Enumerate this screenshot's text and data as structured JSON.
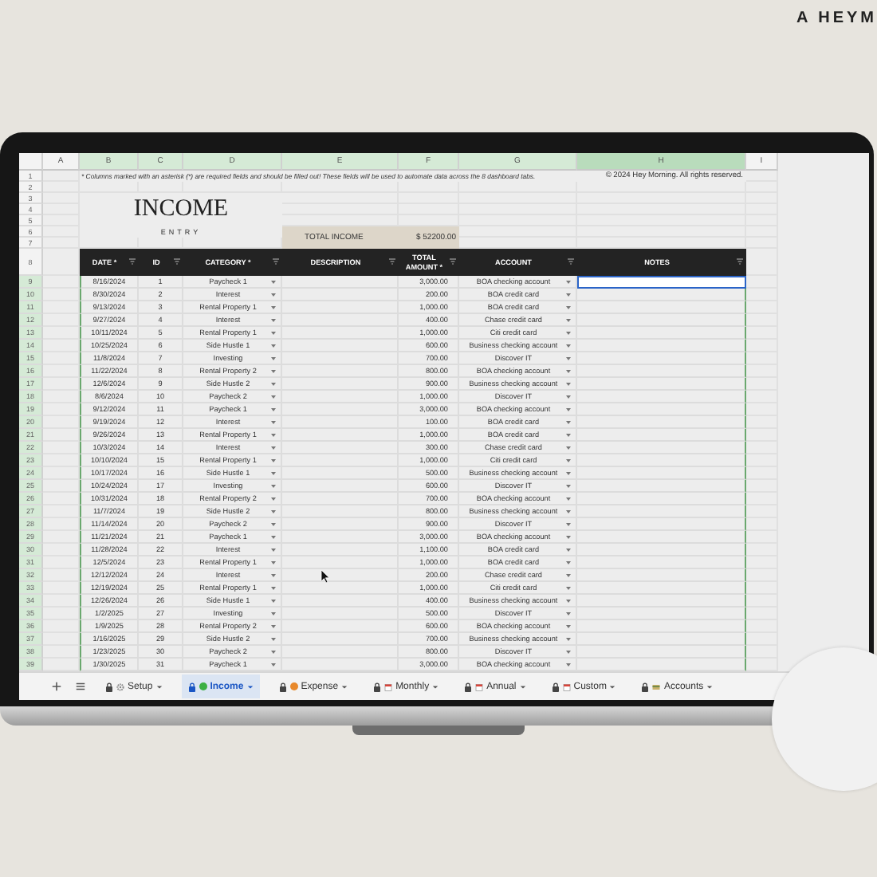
{
  "brand": "A HEYM",
  "columns": [
    {
      "letter": "A",
      "selected": false
    },
    {
      "letter": "B",
      "selected": false
    },
    {
      "letter": "C",
      "selected": false
    },
    {
      "letter": "D",
      "selected": false
    },
    {
      "letter": "E",
      "selected": false
    },
    {
      "letter": "F",
      "selected": false
    },
    {
      "letter": "G",
      "selected": false
    },
    {
      "letter": "H",
      "selected": true
    },
    {
      "letter": "I",
      "selected": false
    }
  ],
  "top_row_numbers": [
    "1",
    "2",
    "3",
    "4",
    "5",
    "6",
    "7"
  ],
  "note": "* Columns marked with an asterisk (*) are required fields and should be filled out! These fields will be used to automate data across the 8 dashboard tabs.",
  "copyright": "© 2024 Hey Morning. All rights reserved.",
  "title": "INCOME",
  "subtitle": "ENTRY",
  "total": {
    "label": "TOTAL INCOME",
    "value": "$ 52200.00"
  },
  "header_row_number": "8",
  "headers": [
    "DATE *",
    "ID",
    "CATEGORY *",
    "DESCRIPTION",
    "TOTAL AMOUNT *",
    "ACCOUNT",
    "NOTES"
  ],
  "rows": [
    {
      "row_number": "9",
      "date": "8/16/2024",
      "id": "1",
      "category": "Paycheck 1",
      "amount": "3,000.00",
      "account": "BOA checking account",
      "selected": true
    },
    {
      "row_number": "10",
      "date": "8/30/2024",
      "id": "2",
      "category": "Interest",
      "amount": "200.00",
      "account": "BOA credit card",
      "selected": false
    },
    {
      "row_number": "11",
      "date": "9/13/2024",
      "id": "3",
      "category": "Rental Property 1",
      "amount": "1,000.00",
      "account": "BOA credit card",
      "selected": false
    },
    {
      "row_number": "12",
      "date": "9/27/2024",
      "id": "4",
      "category": "Interest",
      "amount": "400.00",
      "account": "Chase credit card",
      "selected": false
    },
    {
      "row_number": "13",
      "date": "10/11/2024",
      "id": "5",
      "category": "Rental Property 1",
      "amount": "1,000.00",
      "account": "Citi credit card",
      "selected": false
    },
    {
      "row_number": "14",
      "date": "10/25/2024",
      "id": "6",
      "category": "Side Hustle 1",
      "amount": "600.00",
      "account": "Business checking account",
      "selected": false
    },
    {
      "row_number": "15",
      "date": "11/8/2024",
      "id": "7",
      "category": "Investing",
      "amount": "700.00",
      "account": "Discover IT",
      "selected": false
    },
    {
      "row_number": "16",
      "date": "11/22/2024",
      "id": "8",
      "category": "Rental Property 2",
      "amount": "800.00",
      "account": "BOA checking account",
      "selected": false
    },
    {
      "row_number": "17",
      "date": "12/6/2024",
      "id": "9",
      "category": "Side Hustle 2",
      "amount": "900.00",
      "account": "Business checking account",
      "selected": false
    },
    {
      "row_number": "18",
      "date": "8/6/2024",
      "id": "10",
      "category": "Paycheck 2",
      "amount": "1,000.00",
      "account": "Discover IT",
      "selected": false
    },
    {
      "row_number": "19",
      "date": "9/12/2024",
      "id": "11",
      "category": "Paycheck 1",
      "amount": "3,000.00",
      "account": "BOA checking account",
      "selected": false
    },
    {
      "row_number": "20",
      "date": "9/19/2024",
      "id": "12",
      "category": "Interest",
      "amount": "100.00",
      "account": "BOA credit card",
      "selected": false
    },
    {
      "row_number": "21",
      "date": "9/26/2024",
      "id": "13",
      "category": "Rental Property 1",
      "amount": "1,000.00",
      "account": "BOA credit card",
      "selected": false
    },
    {
      "row_number": "22",
      "date": "10/3/2024",
      "id": "14",
      "category": "Interest",
      "amount": "300.00",
      "account": "Chase credit card",
      "selected": false
    },
    {
      "row_number": "23",
      "date": "10/10/2024",
      "id": "15",
      "category": "Rental Property 1",
      "amount": "1,000.00",
      "account": "Citi credit card",
      "selected": false
    },
    {
      "row_number": "24",
      "date": "10/17/2024",
      "id": "16",
      "category": "Side Hustle 1",
      "amount": "500.00",
      "account": "Business checking account",
      "selected": false
    },
    {
      "row_number": "25",
      "date": "10/24/2024",
      "id": "17",
      "category": "Investing",
      "amount": "600.00",
      "account": "Discover IT",
      "selected": false
    },
    {
      "row_number": "26",
      "date": "10/31/2024",
      "id": "18",
      "category": "Rental Property 2",
      "amount": "700.00",
      "account": "BOA checking account",
      "selected": false
    },
    {
      "row_number": "27",
      "date": "11/7/2024",
      "id": "19",
      "category": "Side Hustle 2",
      "amount": "800.00",
      "account": "Business checking account",
      "selected": false
    },
    {
      "row_number": "28",
      "date": "11/14/2024",
      "id": "20",
      "category": "Paycheck 2",
      "amount": "900.00",
      "account": "Discover IT",
      "selected": false
    },
    {
      "row_number": "29",
      "date": "11/21/2024",
      "id": "21",
      "category": "Paycheck 1",
      "amount": "3,000.00",
      "account": "BOA checking account",
      "selected": false
    },
    {
      "row_number": "30",
      "date": "11/28/2024",
      "id": "22",
      "category": "Interest",
      "amount": "1,100.00",
      "account": "BOA credit card",
      "selected": false
    },
    {
      "row_number": "31",
      "date": "12/5/2024",
      "id": "23",
      "category": "Rental Property 1",
      "amount": "1,000.00",
      "account": "BOA credit card",
      "selected": false
    },
    {
      "row_number": "32",
      "date": "12/12/2024",
      "id": "24",
      "category": "Interest",
      "amount": "200.00",
      "account": "Chase credit card",
      "selected": false
    },
    {
      "row_number": "33",
      "date": "12/19/2024",
      "id": "25",
      "category": "Rental Property 1",
      "amount": "1,000.00",
      "account": "Citi credit card",
      "selected": false
    },
    {
      "row_number": "34",
      "date": "12/26/2024",
      "id": "26",
      "category": "Side Hustle 1",
      "amount": "400.00",
      "account": "Business checking account",
      "selected": false
    },
    {
      "row_number": "35",
      "date": "1/2/2025",
      "id": "27",
      "category": "Investing",
      "amount": "500.00",
      "account": "Discover IT",
      "selected": false
    },
    {
      "row_number": "36",
      "date": "1/9/2025",
      "id": "28",
      "category": "Rental Property 2",
      "amount": "600.00",
      "account": "BOA checking account",
      "selected": false
    },
    {
      "row_number": "37",
      "date": "1/16/2025",
      "id": "29",
      "category": "Side Hustle 2",
      "amount": "700.00",
      "account": "Business checking account",
      "selected": false
    },
    {
      "row_number": "38",
      "date": "1/23/2025",
      "id": "30",
      "category": "Paycheck 2",
      "amount": "800.00",
      "account": "Discover IT",
      "selected": false
    },
    {
      "row_number": "39",
      "date": "1/30/2025",
      "id": "31",
      "category": "Paycheck 1",
      "amount": "3,000.00",
      "account": "BOA checking account",
      "selected": false
    }
  ],
  "sheet_tabs": [
    {
      "label": "Setup",
      "kind": "gear",
      "selected": false
    },
    {
      "label": "Income",
      "kind": "dot",
      "color": "#3cb043",
      "selected": true
    },
    {
      "label": "Expense",
      "kind": "dot",
      "color": "#e8892c",
      "selected": false
    },
    {
      "label": "Monthly",
      "kind": "calendar",
      "selected": false
    },
    {
      "label": "Annual",
      "kind": "calendar",
      "selected": false
    },
    {
      "label": "Custom",
      "kind": "calendar",
      "selected": false
    },
    {
      "label": "Accounts",
      "kind": "card",
      "selected": false
    }
  ]
}
